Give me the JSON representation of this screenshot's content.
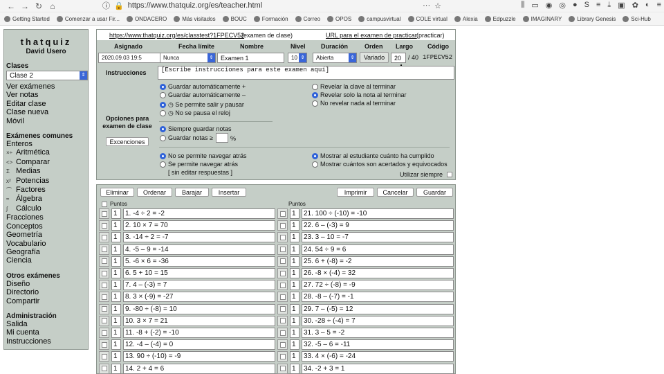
{
  "browser": {
    "url": "https://www.thatquiz.org/es/teacher.html"
  },
  "bookmarks": [
    "Getting Started",
    "Comenzar a usar Fir...",
    "ONDACERO",
    "Más visitados",
    "BOUC",
    "Formación",
    "Correo",
    "OPOS",
    "campusvirtual",
    "COLE virtual",
    "Alexia",
    "Edpuzzle",
    "IMAGINARY",
    "Library Genesis",
    "Sci-Hub"
  ],
  "sidebar": {
    "brand": "thatquiz",
    "user": "David Usero",
    "classes_header": "Clases",
    "class_selected": "Clase 2",
    "class_links": [
      "Ver exámenes",
      "Ver notas",
      "Editar clase",
      "Clase nueva",
      "Móvil"
    ],
    "common_header": "Exámenes comunes",
    "common_links": [
      {
        "icon": "",
        "label": "Enteros"
      },
      {
        "icon": "×÷",
        "label": "Aritmética"
      },
      {
        "icon": "<>",
        "label": "Comparar"
      },
      {
        "icon": "Σ",
        "label": "Medias"
      },
      {
        "icon": "x²",
        "label": "Potencias"
      },
      {
        "icon": "⌒",
        "label": "Factores"
      },
      {
        "icon": "≈",
        "label": "Álgebra"
      },
      {
        "icon": "∫",
        "label": "Cálculo"
      },
      {
        "icon": "",
        "label": "Fracciones"
      },
      {
        "icon": "",
        "label": "Conceptos"
      },
      {
        "icon": "",
        "label": "Geometría"
      },
      {
        "icon": "",
        "label": "Vocabulario"
      },
      {
        "icon": "",
        "label": "Geografía"
      },
      {
        "icon": "",
        "label": "Ciencia"
      }
    ],
    "other_header": "Otros exámenes",
    "other_links": [
      "Diseño",
      "Directorio",
      "Compartir"
    ],
    "admin_header": "Administración",
    "admin_links": [
      "Salida",
      "Mi cuenta",
      "Instrucciones"
    ]
  },
  "panel": {
    "class_test_url": "https://www.thatquiz.org/es/classtest?1FPECV52",
    "class_test_note": "(examen de clase)",
    "practice_link": "URL para el examen de practicar",
    "practice_note": "(practicar)",
    "headers": {
      "assigned": "Asignado",
      "deadline": "Fecha límite",
      "name": "Nombre",
      "level": "Nivel",
      "duration": "Duración",
      "order": "Orden",
      "length": "Largo",
      "code": "Código"
    },
    "values": {
      "assigned": "2020.09.03 19:5",
      "deadline": "Nunca",
      "name": "Examen 1",
      "level": "10",
      "duration": "Abierta",
      "order": "Variado",
      "length": "20",
      "length_total": "/ 40",
      "code": "1FPECV52"
    },
    "instructions_label": "Instrucciones",
    "instructions_placeholder": "[Escribe instrucciones para este examen aquí]",
    "options_label": "Opciones para examen de clase",
    "exceptions_button": "Excenciones",
    "save_options": [
      "Guardar automáticamente +",
      "Guardar automáticamente –"
    ],
    "pause_options": [
      "Se permite salir y pausar",
      "No se pausa el reloj"
    ],
    "reveal_options": [
      "Revelar la clave al terminar",
      "Revelar solo la nota al terminar",
      "No revelar nada al terminar"
    ],
    "grades_options": [
      "Siempre guardar notas",
      "Guardar notas ≥"
    ],
    "percent": "%",
    "nav_options": [
      "No se permite navegar atrás",
      "Se permite navegar atrás"
    ],
    "no_edit": "[ sin editar respuestas ]",
    "show_options": [
      "Mostrar al estudiante cuánto ha cumplido",
      "Mostrar cuántos son acertados y equivocados"
    ],
    "always_use": "Utilizar siempre"
  },
  "toolbar": {
    "delete": "Eliminar",
    "sort": "Ordenar",
    "shuffle": "Barajar",
    "insert": "Insertar",
    "print": "Imprimir",
    "cancel": "Cancelar",
    "save": "Guardar",
    "points": "Puntos"
  },
  "questions_left": [
    {
      "pts": "1",
      "q": "1. -4 ÷ 2 = -2"
    },
    {
      "pts": "1",
      "q": "2. 10 × 7 = 70"
    },
    {
      "pts": "1",
      "q": "3. -14 ÷ 2 = -7"
    },
    {
      "pts": "1",
      "q": "4. -5 – 9 = -14"
    },
    {
      "pts": "1",
      "q": "5. -6 × 6 = -36"
    },
    {
      "pts": "1",
      "q": "6. 5 + 10 = 15"
    },
    {
      "pts": "1",
      "q": "7. 4 – (-3) = 7"
    },
    {
      "pts": "1",
      "q": "8. 3 × (-9) = -27"
    },
    {
      "pts": "1",
      "q": "9. -80 ÷ (-8) = 10"
    },
    {
      "pts": "1",
      "q": "10. 3 × 7 = 21"
    },
    {
      "pts": "1",
      "q": "11. -8 + (-2) = -10"
    },
    {
      "pts": "1",
      "q": "12. -4 – (-4) = 0"
    },
    {
      "pts": "1",
      "q": "13. 90 ÷ (-10) = -9"
    },
    {
      "pts": "1",
      "q": "14. 2 + 4 = 6"
    }
  ],
  "questions_right": [
    {
      "pts": "1",
      "q": "21. 100 ÷ (-10) = -10"
    },
    {
      "pts": "1",
      "q": "22. 6 – (-3) = 9"
    },
    {
      "pts": "1",
      "q": "23. 3 – 10 = -7"
    },
    {
      "pts": "1",
      "q": "24. 54 ÷ 9 = 6"
    },
    {
      "pts": "1",
      "q": "25. 6 + (-8) = -2"
    },
    {
      "pts": "1",
      "q": "26. -8 × (-4) = 32"
    },
    {
      "pts": "1",
      "q": "27. 72 ÷ (-8) = -9"
    },
    {
      "pts": "1",
      "q": "28. -8 – (-7) = -1"
    },
    {
      "pts": "1",
      "q": "29. 7 – (-5) = 12"
    },
    {
      "pts": "1",
      "q": "30. -28 ÷ (-4) = 7"
    },
    {
      "pts": "1",
      "q": "31. 3 – 5 = -2"
    },
    {
      "pts": "1",
      "q": "32. -5 – 6 = -11"
    },
    {
      "pts": "1",
      "q": "33. 4 × (-6) = -24"
    },
    {
      "pts": "1",
      "q": "34. -2 + 3 = 1"
    }
  ]
}
